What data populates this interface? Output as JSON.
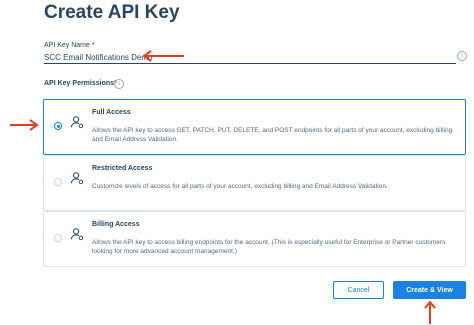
{
  "page": {
    "title": "Create API Key"
  },
  "key_name": {
    "label": "API Key Name",
    "required_mark": "*",
    "value": "SCC Email Notifications Demo",
    "info_glyph": "i"
  },
  "permissions": {
    "title": "API Key Permissions",
    "required_mark": "*",
    "info_glyph": "i",
    "options": [
      {
        "name": "Full Access",
        "description": "Allows the API key to access GET, PATCH, PUT, DELETE, and POST endpoints for all parts of your account, excluding billing and Email Address Validation.",
        "selected": true
      },
      {
        "name": "Restricted Access",
        "description": "Customize levels of access for all parts of your account, excluding billing and Email Address Validation.",
        "selected": false
      },
      {
        "name": "Billing Access",
        "description": "Allows the API key to access billing endpoints for the account. (This is especially useful for Enterprise or Partner customers looking for more advanced account management.)",
        "selected": false
      }
    ]
  },
  "actions": {
    "cancel_label": "Cancel",
    "create_label": "Create & View"
  },
  "colors": {
    "accent": "#1a82e2",
    "text": "#294661",
    "annotation": "#e0401b"
  },
  "icons": [
    "user-gear-icon",
    "info-icon"
  ]
}
